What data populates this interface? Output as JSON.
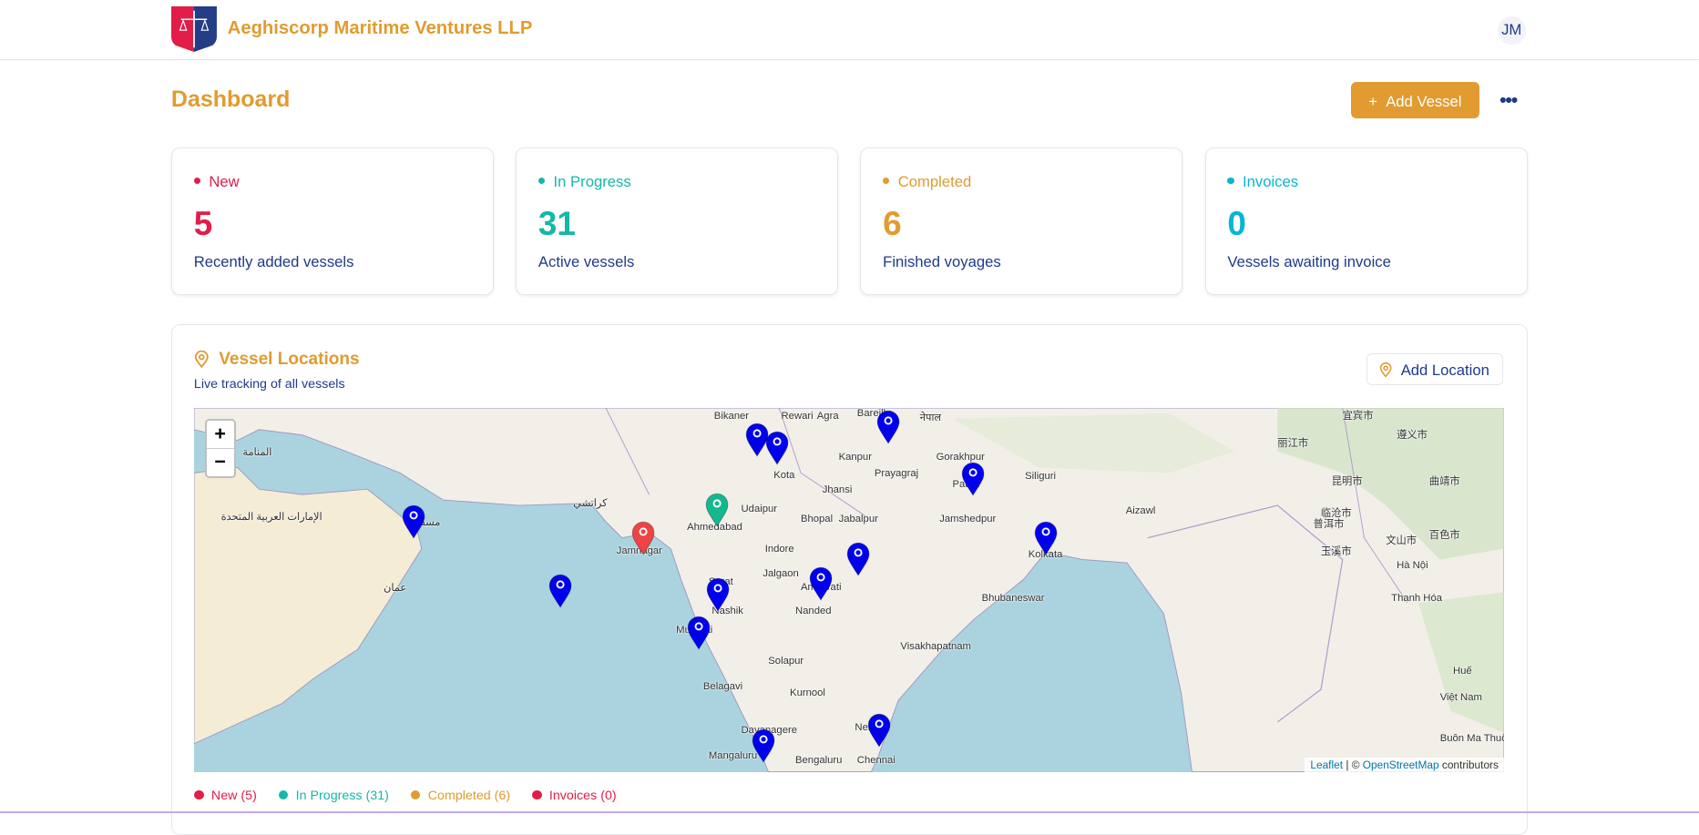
{
  "header": {
    "company": "Aeghiscorp Maritime Ventures LLP",
    "avatar_initials": "JM"
  },
  "page": {
    "title": "Dashboard",
    "add_vessel_label": "Add Vessel",
    "add_icon": "+",
    "more_icon": "•••"
  },
  "colors": {
    "brand": "#e19b30",
    "new": "#e11d48",
    "in_progress": "#14b8a6",
    "completed": "#e19b30",
    "invoices": "#06b6d4",
    "marker_blue": "#0000ee",
    "marker_green": "#14b88f",
    "marker_red": "#ef4444"
  },
  "stats": [
    {
      "label": "New",
      "value": "5",
      "description": "Recently added vessels"
    },
    {
      "label": "In Progress",
      "value": "31",
      "description": "Active vessels"
    },
    {
      "label": "Completed",
      "value": "6",
      "description": "Finished voyages"
    },
    {
      "label": "Invoices",
      "value": "0",
      "description": "Vessels awaiting invoice"
    }
  ],
  "map_panel": {
    "title": "Vessel Locations",
    "subtitle": "Live tracking of all vessels",
    "add_location_label": "Add Location",
    "zoom_in": "+",
    "zoom_out": "−",
    "attribution": {
      "leaflet": "Leaflet",
      "sep": " | © ",
      "osm": "OpenStreetMap",
      "suffix": " contributors"
    },
    "place_labels": [
      "Bikaner",
      "Rewari",
      "Agra",
      "Bareilly",
      "नेपाल",
      "Kota",
      "Kanpur",
      "Prayagraj",
      "Gorakhpur",
      "Jhansi",
      "Siliguri",
      "Patna",
      "Udaipur",
      "Ahmedabad",
      "Bhopal",
      "Jabalpur",
      "Jamshedpur",
      "Kolkata",
      "Jamnagar",
      "Indore",
      "Jalgaon",
      "Amravati",
      "Bhubaneswar",
      "Surat",
      "Nashik",
      "Nanded",
      "Mumbai",
      "Solapur",
      "Visakhapatnam",
      "Belagavi",
      "Kurnool",
      "Davanagere",
      "Mangaluru",
      "Bengaluru",
      "Nellore",
      "Chennai",
      "Aizawl",
      "كراتشي",
      "مسقط",
      "عمان",
      "المنامة",
      "الإمارات العربية المتحدة",
      "Hà Nội",
      "Thanh Hóa",
      "Huế",
      "Việt Nam",
      "Buôn Ma Thuột",
      "宜宾市",
      "遵义市",
      "丽江市",
      "昆明市",
      "曲靖市",
      "临沧市",
      "玉溪市",
      "普洱市",
      "文山市",
      "百色市"
    ],
    "markers": [
      {
        "status": "in_progress",
        "color": "blue"
      },
      {
        "status": "in_progress",
        "color": "blue"
      },
      {
        "status": "new",
        "color": "red"
      },
      {
        "status": "completed",
        "color": "green"
      },
      {
        "status": "in_progress",
        "color": "blue"
      },
      {
        "status": "in_progress",
        "color": "blue"
      },
      {
        "status": "in_progress",
        "color": "blue"
      },
      {
        "status": "in_progress",
        "color": "blue"
      },
      {
        "status": "in_progress",
        "color": "blue"
      },
      {
        "status": "in_progress",
        "color": "blue"
      },
      {
        "status": "in_progress",
        "color": "blue"
      },
      {
        "status": "in_progress",
        "color": "blue"
      },
      {
        "status": "in_progress",
        "color": "blue"
      },
      {
        "status": "in_progress",
        "color": "blue"
      },
      {
        "status": "in_progress",
        "color": "blue"
      }
    ]
  },
  "legend": [
    "New (5)",
    "In Progress (31)",
    "Completed (6)",
    "Invoices (0)"
  ]
}
